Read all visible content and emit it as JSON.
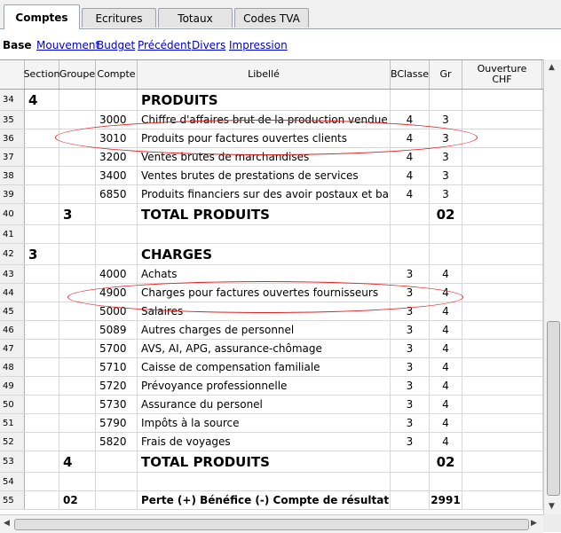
{
  "tabs": [
    {
      "label": "Comptes",
      "active": true
    },
    {
      "label": "Ecritures",
      "active": false
    },
    {
      "label": "Totaux",
      "active": false
    },
    {
      "label": "Codes TVA",
      "active": false
    }
  ],
  "views": {
    "active": "Base",
    "links": [
      "Mouvement",
      "Budget",
      "Précédent",
      "Divers",
      "Impression"
    ]
  },
  "columns": {
    "section": "Section",
    "groupe": "Groupe",
    "compte": "Compte",
    "libelle": "Libellé",
    "bclasse": "BClasse",
    "gr": "Gr",
    "ouverture_l1": "Ouverture",
    "ouverture_l2": "CHF"
  },
  "rows": [
    {
      "n": "34",
      "section": "4",
      "groupe": "",
      "compte": "",
      "libelle": "PRODUITS",
      "bclasse": "",
      "gr": "",
      "style": "big"
    },
    {
      "n": "35",
      "section": "",
      "groupe": "",
      "compte": "3000",
      "libelle": "Chiffre d'affaires brut de la production vendue",
      "bclasse": "4",
      "gr": "3",
      "style": ""
    },
    {
      "n": "36",
      "section": "",
      "groupe": "",
      "compte": "3010",
      "libelle": "Produits pour factures ouvertes clients",
      "bclasse": "4",
      "gr": "3",
      "style": ""
    },
    {
      "n": "37",
      "section": "",
      "groupe": "",
      "compte": "3200",
      "libelle": "Ventes brutes de marchandises",
      "bclasse": "4",
      "gr": "3",
      "style": ""
    },
    {
      "n": "38",
      "section": "",
      "groupe": "",
      "compte": "3400",
      "libelle": "Ventes brutes de prestations de services",
      "bclasse": "4",
      "gr": "3",
      "style": ""
    },
    {
      "n": "39",
      "section": "",
      "groupe": "",
      "compte": "6850",
      "libelle": "Produits financiers sur des avoir postaux et banc",
      "bclasse": "4",
      "gr": "3",
      "style": ""
    },
    {
      "n": "40",
      "section": "",
      "groupe": "3",
      "compte": "",
      "libelle": "TOTAL PRODUITS",
      "bclasse": "",
      "gr": "02",
      "style": "big"
    },
    {
      "n": "41",
      "section": "",
      "groupe": "",
      "compte": "",
      "libelle": "",
      "bclasse": "",
      "gr": "",
      "style": ""
    },
    {
      "n": "42",
      "section": "3",
      "groupe": "",
      "compte": "",
      "libelle": "CHARGES",
      "bclasse": "",
      "gr": "",
      "style": "big"
    },
    {
      "n": "43",
      "section": "",
      "groupe": "",
      "compte": "4000",
      "libelle": "Achats",
      "bclasse": "3",
      "gr": "4",
      "style": ""
    },
    {
      "n": "44",
      "section": "",
      "groupe": "",
      "compte": "4900",
      "libelle": "Charges pour factures ouvertes fournisseurs",
      "bclasse": "3",
      "gr": "4",
      "style": ""
    },
    {
      "n": "45",
      "section": "",
      "groupe": "",
      "compte": "5000",
      "libelle": "Salaires",
      "bclasse": "3",
      "gr": "4",
      "style": ""
    },
    {
      "n": "46",
      "section": "",
      "groupe": "",
      "compte": "5089",
      "libelle": "Autres charges de personnel",
      "bclasse": "3",
      "gr": "4",
      "style": ""
    },
    {
      "n": "47",
      "section": "",
      "groupe": "",
      "compte": "5700",
      "libelle": "AVS, AI, APG, assurance-chômage",
      "bclasse": "3",
      "gr": "4",
      "style": ""
    },
    {
      "n": "48",
      "section": "",
      "groupe": "",
      "compte": "5710",
      "libelle": "Caisse de compensation familiale",
      "bclasse": "3",
      "gr": "4",
      "style": ""
    },
    {
      "n": "49",
      "section": "",
      "groupe": "",
      "compte": "5720",
      "libelle": "Prévoyance professionnelle",
      "bclasse": "3",
      "gr": "4",
      "style": ""
    },
    {
      "n": "50",
      "section": "",
      "groupe": "",
      "compte": "5730",
      "libelle": "Assurance du personel",
      "bclasse": "3",
      "gr": "4",
      "style": ""
    },
    {
      "n": "51",
      "section": "",
      "groupe": "",
      "compte": "5790",
      "libelle": "Impôts à la source",
      "bclasse": "3",
      "gr": "4",
      "style": ""
    },
    {
      "n": "52",
      "section": "",
      "groupe": "",
      "compte": "5820",
      "libelle": "Frais de voyages",
      "bclasse": "3",
      "gr": "4",
      "style": ""
    },
    {
      "n": "53",
      "section": "",
      "groupe": "4",
      "compte": "",
      "libelle": "TOTAL PRODUITS",
      "bclasse": "",
      "gr": "02",
      "style": "big"
    },
    {
      "n": "54",
      "section": "",
      "groupe": "",
      "compte": "",
      "libelle": "",
      "bclasse": "",
      "gr": "",
      "style": ""
    },
    {
      "n": "55",
      "section": "",
      "groupe": "02",
      "compte": "",
      "libelle": "Perte (+) Bénéfice (-) Compte de résultat",
      "bclasse": "",
      "gr": "2991",
      "style": "bold"
    }
  ],
  "highlighted_rows": [
    "36",
    "44"
  ],
  "colors": {
    "highlight": "#d22222",
    "link": "#0000cc"
  }
}
